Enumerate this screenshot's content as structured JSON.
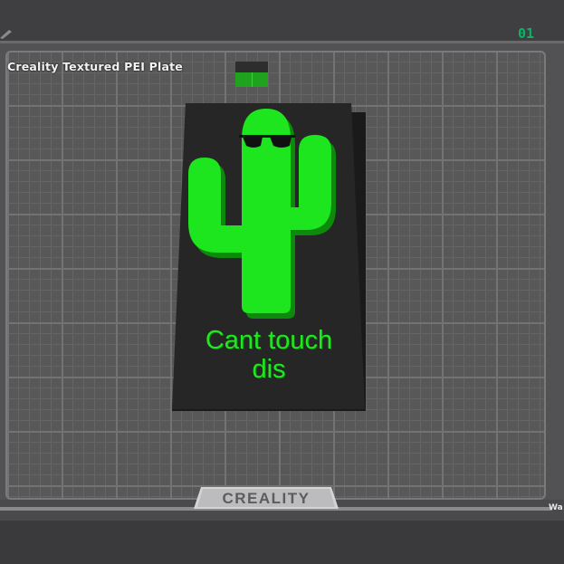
{
  "plate": {
    "name": "Creality Textured PEI Plate",
    "index": "01"
  },
  "model": {
    "text_line1": "Cant touch",
    "text_line2": "dis",
    "body_color": "#1ee61e",
    "base_color": "#262626"
  },
  "bed": {
    "brand": "CREALITY",
    "edge_label": "Wa"
  },
  "colors": {
    "accent": "#11b06a",
    "background": "#3f3f41",
    "grid": "#737373"
  },
  "icons": {
    "corner": "edit-icon",
    "toggle": "plate-settings-icon"
  }
}
